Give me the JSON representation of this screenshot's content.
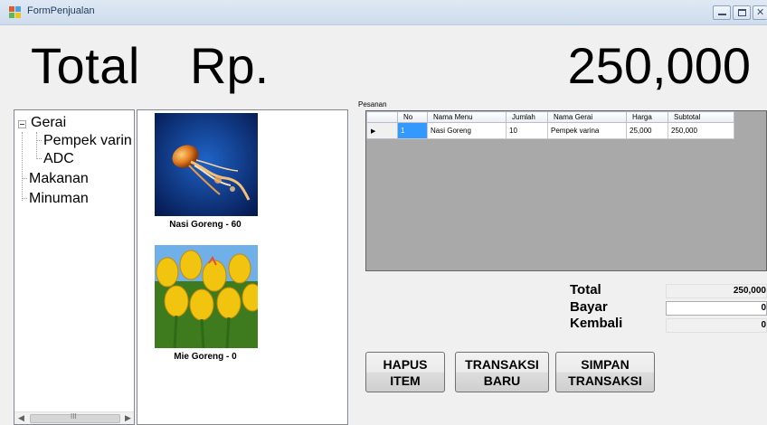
{
  "window": {
    "title": "FormPenjualan"
  },
  "header": {
    "total_label": "Total",
    "currency_label": "Rp.",
    "amount": "250,000"
  },
  "tree": {
    "root": "Gerai",
    "children": [
      "Pempek varin",
      "ADC"
    ],
    "other_nodes": [
      "Makanan",
      "Minuman"
    ],
    "scroll_thumb_glyph": "III"
  },
  "menu_items": [
    {
      "caption": "Nasi Goreng - 60",
      "image": "jellyfish-photo"
    },
    {
      "caption": "Mie Goreng - 0",
      "image": "tulips-photo"
    }
  ],
  "orders": {
    "label": "Pesanan",
    "columns": [
      "No",
      "Nama Menu",
      "Jumlah",
      "Nama Gerai",
      "Harga",
      "Subtotal"
    ],
    "rows": [
      {
        "no": "1",
        "nama_menu": "Nasi Goreng",
        "jumlah": "10",
        "nama_gerai": "Pempek varina",
        "harga": "25,000",
        "subtotal": "250,000"
      }
    ],
    "current_row_glyph": "▶"
  },
  "summary": {
    "total_label": "Total",
    "total_value": "250,000",
    "bayar_label": "Bayar",
    "bayar_value": "0",
    "kembali_label": "Kembali",
    "kembali_value": "0"
  },
  "buttons": {
    "hapus_line1": "HAPUS",
    "hapus_line2": "ITEM",
    "transaksi_baru_line1": "TRANSAKSI",
    "transaksi_baru_line2": "BARU",
    "simpan_line1": "SIMPAN",
    "simpan_line2": "TRANSAKSI"
  }
}
